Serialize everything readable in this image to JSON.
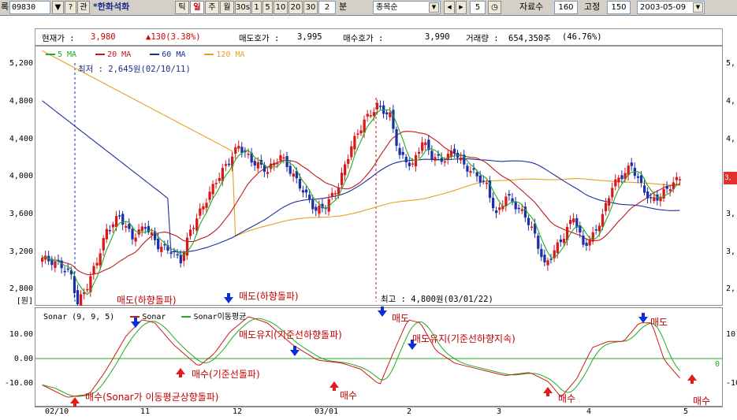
{
  "toolbar": {
    "left_glyph": "록",
    "code": "09830",
    "btn_dropdown": "▼",
    "btn_help": "?",
    "btn_related": "관",
    "name": "*한화석화",
    "periods": [
      "틱",
      "일",
      "주",
      "월",
      "30s",
      "1",
      "5",
      "10",
      "20",
      "30"
    ],
    "selected_period": "일",
    "minute_value": "2",
    "minute_label": "분",
    "sort_select": "종목순",
    "step_value": "5",
    "count_label": "자료수",
    "count_value": "160",
    "fixed_label": "고정",
    "fixed_value": "150",
    "date_value": "2003-05-09"
  },
  "infobar": {
    "price_label": "현재가 :",
    "price_value": "3,980",
    "change": "▲130(3.38%)",
    "ask_label": "매도호가 :",
    "ask_value": "3,995",
    "bid_label": "매수호가 :",
    "bid_value": "3,990",
    "volume_label": "거래량 :",
    "volume_value": "654,350주",
    "volume_pct": "(46.76%)"
  },
  "price_axis": [
    "5,200",
    "4,800",
    "4,400",
    "4,000",
    "3,600",
    "3,200",
    "2,800"
  ],
  "price_axis_right": [
    "5,",
    "4,",
    "4,",
    "3,",
    "3,",
    "2,"
  ],
  "price_tag": "3,",
  "unit_label": "[원]",
  "legend": [
    {
      "label": "5 MA",
      "color": "#22aa22"
    },
    {
      "label": "20 MA",
      "color": "#c0181c"
    },
    {
      "label": "60 MA",
      "color": "#1b2f9a"
    },
    {
      "label": "120 MA",
      "color": "#e8a020"
    }
  ],
  "low_note": "최저 : 2,645원(02/10/11)",
  "high_note": "최고 : 4,800원(03/01/22)",
  "sonar_legend": {
    "title": "Sonar (9, 9, 5)",
    "sonar": "Sonar",
    "sonar_color": "#d01818",
    "signal": "Sonar이동평균",
    "signal_color": "#22aa22"
  },
  "sonar_axis": [
    "10.00",
    "0.00",
    "-10.00"
  ],
  "sonar_axis_right": [
    "10",
    "0",
    "-10"
  ],
  "sonar_zero_label": "0",
  "annotations": {
    "sell1": "매도(하향돌파)",
    "sell2": "매도(하향돌파)",
    "hold1": "매도유지(기준선하향돌파)",
    "sell3": "매도",
    "hold2": "매도유지(기준선하향지속)",
    "sell4": "매도",
    "buy1": "매수(Sonar가 이동평균상향돌파)",
    "buy2": "매수(기준선돌파)",
    "buy3": "매수",
    "buy4": "매수",
    "buy5": "매수"
  },
  "x_dates": [
    "02/10",
    "11",
    "12",
    "03/01",
    "2",
    "3",
    "4",
    "5"
  ],
  "colors": {
    "up_candle": "#d7191c",
    "down_candle": "#1b2fa8",
    "toolbar_bg": "#d4d0c8",
    "sell_arrow": "#0a2fd6",
    "buy_arrow": "#e21b1b"
  },
  "chart_data": {
    "type": "candlestick",
    "title": "",
    "xlabel": "",
    "ylabel": "",
    "ylim": [
      2700,
      5300
    ],
    "x": [
      "02/10",
      "11",
      "12",
      "03/01",
      "2",
      "3",
      "4",
      "5"
    ],
    "ma_periods": [
      5,
      20,
      60,
      120
    ],
    "low": {
      "value": 2645,
      "date": "02/10/11"
    },
    "high": {
      "value": 4800,
      "date": "03/01/22"
    },
    "last_close": 3980,
    "sonar": {
      "params": [
        9,
        9,
        5
      ],
      "ylim": [
        -15,
        17
      ],
      "zero_line": 0
    }
  }
}
